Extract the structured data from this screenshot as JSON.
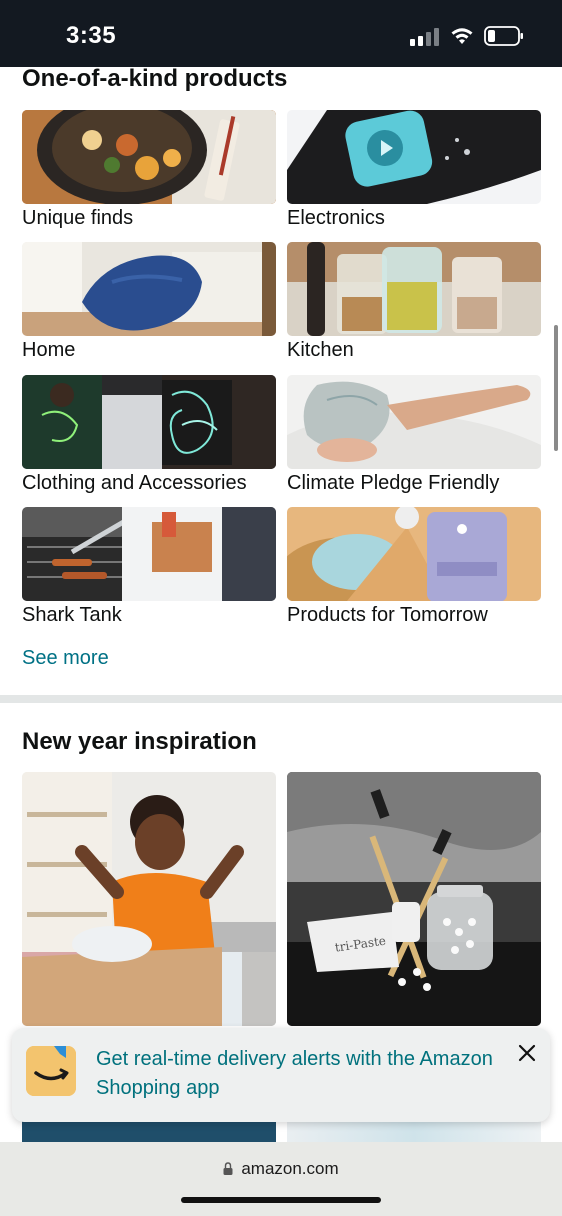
{
  "status_bar": {
    "time": "3:35"
  },
  "section_one": {
    "title": "One-of-a-kind products",
    "tiles": [
      {
        "label": "Unique finds"
      },
      {
        "label": "Electronics"
      },
      {
        "label": "Home"
      },
      {
        "label": "Kitchen"
      },
      {
        "label": "Clothing and Accessories"
      },
      {
        "label": "Climate Pledge Friendly"
      },
      {
        "label": "Shark Tank"
      },
      {
        "label": "Products for Tomorrow"
      }
    ],
    "see_more": "See more"
  },
  "section_two": {
    "title": "New year inspiration",
    "paste_label": "tri-Paste"
  },
  "banner": {
    "text": "Get real-time delivery alerts with the Amazon Shopping app",
    "close_icon": "close-icon"
  },
  "url_bar": {
    "domain": "amazon.com"
  },
  "colors": {
    "link": "#007185",
    "banner_text": "#00717d",
    "status_bar": "#131921"
  }
}
